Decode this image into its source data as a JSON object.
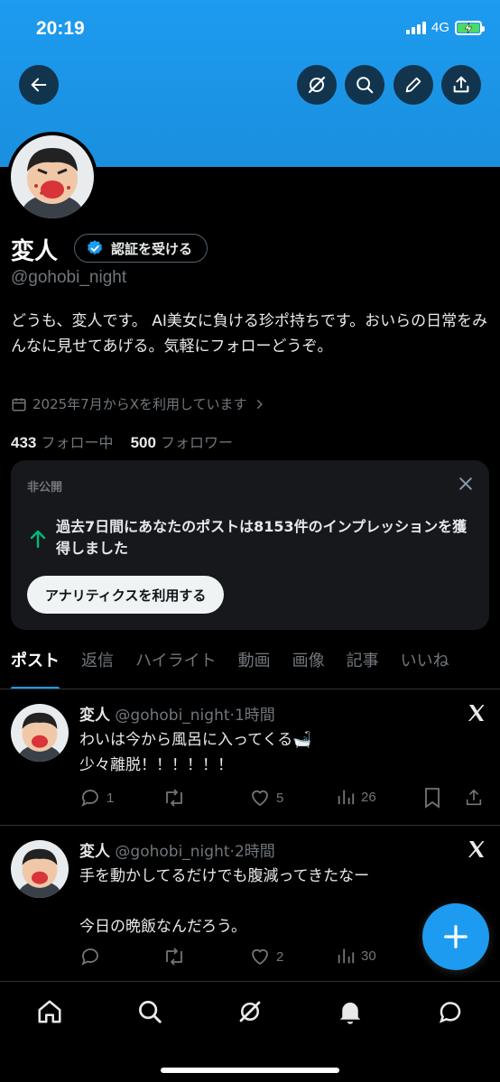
{
  "status_bar": {
    "time": "20:19",
    "network": "4G"
  },
  "header": {
    "back_icon": "arrow-left-icon",
    "grok_icon": "grok-icon",
    "search_icon": "search-icon",
    "edit_icon": "pencil-icon",
    "share_icon": "share-icon",
    "banner_color": "#1d9bf0"
  },
  "profile": {
    "name": "変人",
    "verify_label": "認証を受ける",
    "handle": "@gohobi_night",
    "bio": "どうも、変人です。 AI美女に負ける珍ポ持ちです。おいらの日常をみんなに見せてあげる。気軽にフォローどうぞ。",
    "joined": "2025年7月からXを利用しています",
    "following_count": "433",
    "following_label": "フォロー中",
    "followers_count": "500",
    "followers_label": "フォロワー"
  },
  "analytics_card": {
    "label": "非公開",
    "text": "過去7日間にあなたのポストは8153件のインプレッションを獲得しました",
    "button": "アナリティクスを利用する"
  },
  "tabs": [
    "ポスト",
    "返信",
    "ハイライト",
    "動画",
    "画像",
    "記事",
    "いいね"
  ],
  "posts": [
    {
      "name": "変人",
      "handle": "@gohobi_night",
      "time": "1時間",
      "line1": "わいは今から風呂に入ってくる🛁",
      "line2": "少々離脱！！！！！！",
      "replies": "1",
      "retweets": "",
      "likes": "5",
      "views": "26"
    },
    {
      "name": "変人",
      "handle": "@gohobi_night",
      "time": "2時間",
      "line1": "手を動かしてるだけでも腹減ってきたなー",
      "line2": "今日の晩飯なんだろう。",
      "replies": "",
      "retweets": "",
      "likes": "2",
      "views": "30"
    }
  ],
  "fab_icon": "plus-icon",
  "bottom_nav": [
    "home-icon",
    "search-icon",
    "grok-icon",
    "bell-icon",
    "message-icon"
  ],
  "colors": {
    "accent": "#1d9bf0",
    "background": "#000000",
    "muted": "#71767b"
  }
}
